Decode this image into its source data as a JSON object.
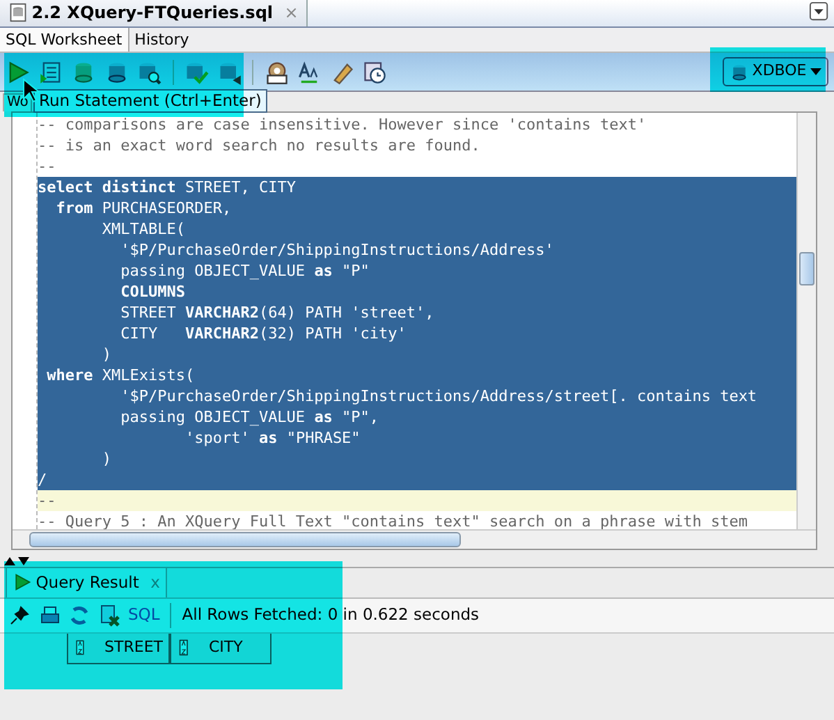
{
  "file_tab": {
    "title": "2.2 XQuery-FTQueries.sql",
    "close": "×"
  },
  "sub_tabs": [
    {
      "label": "SQL Worksheet",
      "selected": true
    },
    {
      "label": "History",
      "selected": false
    }
  ],
  "connection": "XDBOE",
  "worksheet_tab": "Wo",
  "tooltip": "Run Statement (Ctrl+Enter)",
  "editor_lines": [
    {
      "text": "-- comparisons are case insensitive. However since 'contains text'",
      "kind": "comment",
      "selected": false
    },
    {
      "text": "-- is an exact word search no results are found.",
      "kind": "comment",
      "selected": false
    },
    {
      "text": "--",
      "kind": "comment",
      "selected": false
    },
    {
      "text": "**select** **distinct** STREET, CITY",
      "kind": "code",
      "selected": true
    },
    {
      "text": "  **from** PURCHASEORDER,",
      "kind": "code",
      "selected": true
    },
    {
      "text": "       XMLTABLE(",
      "kind": "code",
      "selected": true
    },
    {
      "text": "         '$P/PurchaseOrder/ShippingInstructions/Address'",
      "kind": "code",
      "selected": true
    },
    {
      "text": "         passing OBJECT_VALUE **as** \"P\"",
      "kind": "code",
      "selected": true
    },
    {
      "text": "         **COLUMNS**",
      "kind": "code",
      "selected": true
    },
    {
      "text": "         STREET **VARCHAR2**(64) PATH 'street',",
      "kind": "code",
      "selected": true
    },
    {
      "text": "         CITY   **VARCHAR2**(32) PATH 'city'",
      "kind": "code",
      "selected": true
    },
    {
      "text": "       )",
      "kind": "code",
      "selected": true
    },
    {
      "text": " **where** XMLExists(",
      "kind": "code",
      "selected": true
    },
    {
      "text": "         '$P/PurchaseOrder/ShippingInstructions/Address/street[. contains text",
      "kind": "code",
      "selected": true
    },
    {
      "text": "         passing OBJECT_VALUE **as** \"P\",",
      "kind": "code",
      "selected": true
    },
    {
      "text": "                'sport' **as** \"PHRASE\"",
      "kind": "code",
      "selected": true
    },
    {
      "text": "       )",
      "kind": "code",
      "selected": true
    },
    {
      "text": "/",
      "kind": "code",
      "selected": true
    },
    {
      "text": "--",
      "kind": "current",
      "selected": false
    },
    {
      "text": "-- Query 5 : An XQuery Full Text \"contains text\" search on a phrase with stem",
      "kind": "comment",
      "selected": false
    }
  ],
  "result_tab": {
    "title": "Query Result",
    "close": "x"
  },
  "result_toolbar": {
    "sql_link": "SQL",
    "status": "All Rows Fetched: 0 in 0.622 seconds"
  },
  "result_columns": [
    "STREET",
    "CITY"
  ]
}
